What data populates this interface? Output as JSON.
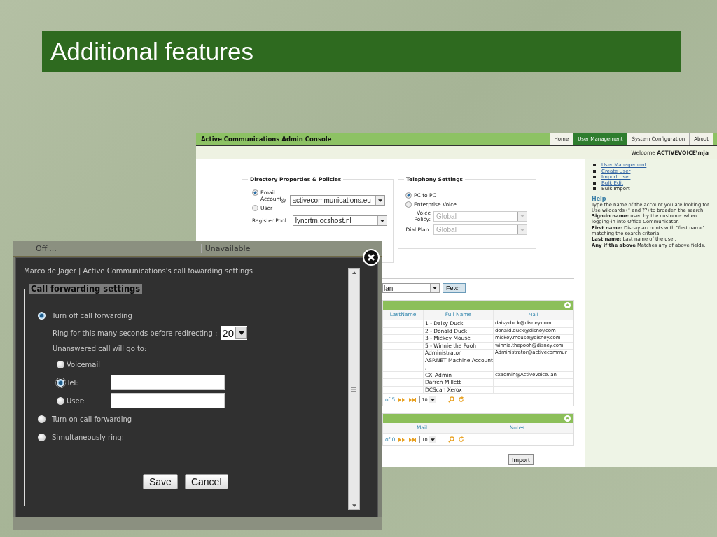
{
  "slide_title": "Additional features",
  "console": {
    "title": "Active Communications Admin Console",
    "tabs": [
      {
        "label": "Home",
        "selected": false
      },
      {
        "label": "User Management",
        "selected": true
      },
      {
        "label": "System Configuration",
        "selected": false
      },
      {
        "label": "About",
        "selected": false
      }
    ],
    "welcome": "Welcome **ACTIVEVOICE\\mja**",
    "directory": {
      "legend": "Directory Properties & Policies",
      "account_options": [
        {
          "label": "Email Account",
          "selected": true
        },
        {
          "label": "User",
          "selected": false
        }
      ],
      "at_sign": "@",
      "domain": "activecommunications.eu",
      "register_pool_label": "Register Pool:",
      "register_pool": "lyncrtm.ocshost.nl"
    },
    "telephony": {
      "legend": "Telephony Settings",
      "options": [
        {
          "label": "PC to PC",
          "selected": true
        },
        {
          "label": "Enterprise Voice",
          "selected": false
        }
      ],
      "fields": [
        {
          "label": "Voice Policy:",
          "value": "Global",
          "disabled": true
        },
        {
          "label": "Dial Plan:",
          "value": "Global",
          "disabled": true
        }
      ]
    },
    "search": {
      "value": "lan",
      "button": "Fetch"
    },
    "users_table": {
      "columns": [
        "LastName",
        "Full Name",
        "Mail"
      ],
      "rows": [
        {
          "full_name": "1 - Daisy Duck",
          "mail": "daisy.duck@disney.com"
        },
        {
          "full_name": "2 - Donald Duck",
          "mail": "donald.duck@disney.com"
        },
        {
          "full_name": "3 - Mickey Mouse",
          "mail": "mickey.mouse@disney.com"
        },
        {
          "full_name": "5 - Winnie the Pooh",
          "mail": "winnie.thepooh@disney.com"
        },
        {
          "full_name": "Administrator",
          "mail": "Administrator@activecommur"
        },
        {
          "full_name": "ASP.NET Machine Account"
        },
        {
          "full_name": ","
        },
        {
          "full_name": "CX_Admin",
          "mail": "cxadmin@ActiveVoice.lan"
        },
        {
          "full_name": "Darren Millett"
        },
        {
          "full_name": "DCScan Xerox"
        }
      ],
      "pager": {
        "page_count": "of 5",
        "page_size": "10"
      }
    },
    "second_table": {
      "columns": [
        "Mail",
        "Notes"
      ],
      "pager": {
        "page_count": "of 0",
        "page_size": "10"
      }
    },
    "import_button": "Import",
    "side_links": [
      {
        "label": "User Management",
        "link": true
      },
      {
        "label": "Create User",
        "link": true
      },
      {
        "label": "Import User",
        "link": true
      },
      {
        "label": "Bulk Edit",
        "link": true
      },
      {
        "label": "Bulk Import",
        "link": false
      }
    ],
    "help": {
      "title": "Help",
      "lines": [
        "Type the name of the account you are looking for.",
        "Use wildcards (* and ??) to broaden the search.",
        "**Sign-in name:** used by the customer when logging-in into Office Communicator.",
        "**First name:** Dispay accounts with \"first name\" matching the search criteria.",
        "**Last name:** Last name of the user.",
        "**Any if the above** Matches any of above fields."
      ]
    }
  },
  "dialog": {
    "background_row": {
      "status": "Off",
      "link": "...",
      "availability": "Unavailable"
    },
    "header": "Marco de Jager | Active Communications's call fowarding settings",
    "legend": "Call forwarding settings",
    "options": [
      {
        "kind": "radio",
        "label": "Turn off call forwarding",
        "selected": true
      },
      {
        "kind": "ring",
        "label": "Ring for this many seconds before redirecting :",
        "value": "20"
      },
      {
        "kind": "note",
        "label": "Unanswered call will go to:"
      },
      {
        "kind": "target",
        "label": "Voicemail",
        "selected": false
      },
      {
        "kind": "target_input",
        "label": "Tel:",
        "selected": true
      },
      {
        "kind": "target_input",
        "label": "User:",
        "selected": false
      },
      {
        "kind": "radio",
        "label": "Turn on call forwarding",
        "selected": false
      },
      {
        "kind": "radio",
        "label": "Simultaneously ring:",
        "selected": false
      }
    ],
    "buttons": [
      "Save",
      "Cancel"
    ]
  }
}
